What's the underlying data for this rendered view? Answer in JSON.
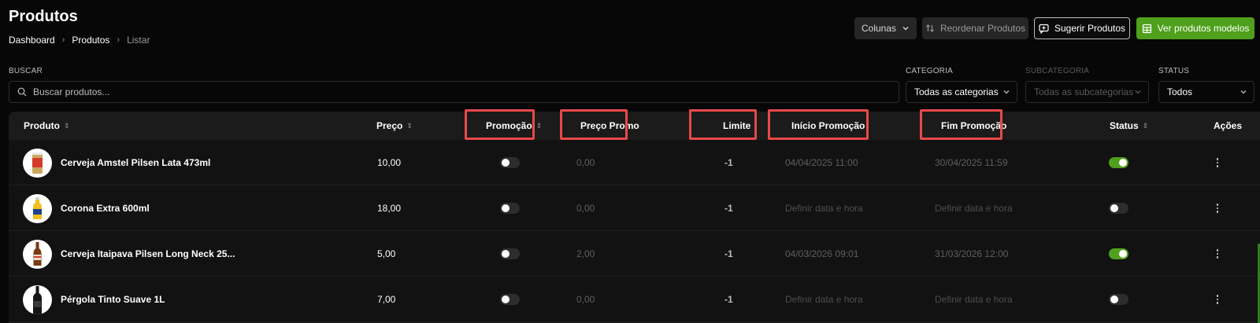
{
  "page": {
    "title": "Produtos",
    "breadcrumb": [
      "Dashboard",
      "Produtos",
      "Listar"
    ]
  },
  "toolbar": {
    "columns_label": "Colunas",
    "reorder_label": "Reordenar Produtos",
    "suggest_label": "Sugerir Produtos",
    "models_label": "Ver produtos modelos"
  },
  "filters": {
    "search_label": "BUSCAR",
    "search_placeholder": "Buscar produtos...",
    "category_label": "CATEGORIA",
    "category_value": "Todas as categorias",
    "subcategory_label": "SUBCATEGORIA",
    "subcategory_value": "Todas as subcategorias",
    "status_label": "STATUS",
    "status_value": "Todos"
  },
  "table": {
    "columns": {
      "produto": "Produto",
      "preco": "Preço",
      "promocao": "Promoção",
      "preco_promo": "Preço Promo",
      "limite": "Limite",
      "inicio": "Início Promoção",
      "fim": "Fim Promoção",
      "status": "Status",
      "acoes": "Ações"
    },
    "rows": [
      {
        "name": "Cerveja Amstel Pilsen Lata 473ml",
        "price": "10,00",
        "promo": false,
        "promo_price": "0,00",
        "limit": "-1",
        "start": "04/04/2025 11:00",
        "end": "30/04/2025 11:59",
        "status": true
      },
      {
        "name": "Corona Extra 600ml",
        "price": "18,00",
        "promo": false,
        "promo_price": "0,00",
        "limit": "-1",
        "start": "Definir data e hora",
        "end": "Definir data e hora",
        "status": false
      },
      {
        "name": "Cerveja Itaipava Pilsen Long Neck 25...",
        "price": "5,00",
        "promo": false,
        "promo_price": "2,00",
        "limit": "-1",
        "start": "04/03/2026 09:01",
        "end": "31/03/2026 12:00",
        "status": true
      },
      {
        "name": "Pérgola Tinto Suave 1L",
        "price": "7,00",
        "promo": false,
        "promo_price": "0,00",
        "limit": "-1",
        "start": "Definir data e hora",
        "end": "Definir data e hora",
        "status": false
      }
    ]
  },
  "colors": {
    "accent_green": "#4fa01c",
    "highlight_red": "#e8494a",
    "background": "#070707"
  }
}
